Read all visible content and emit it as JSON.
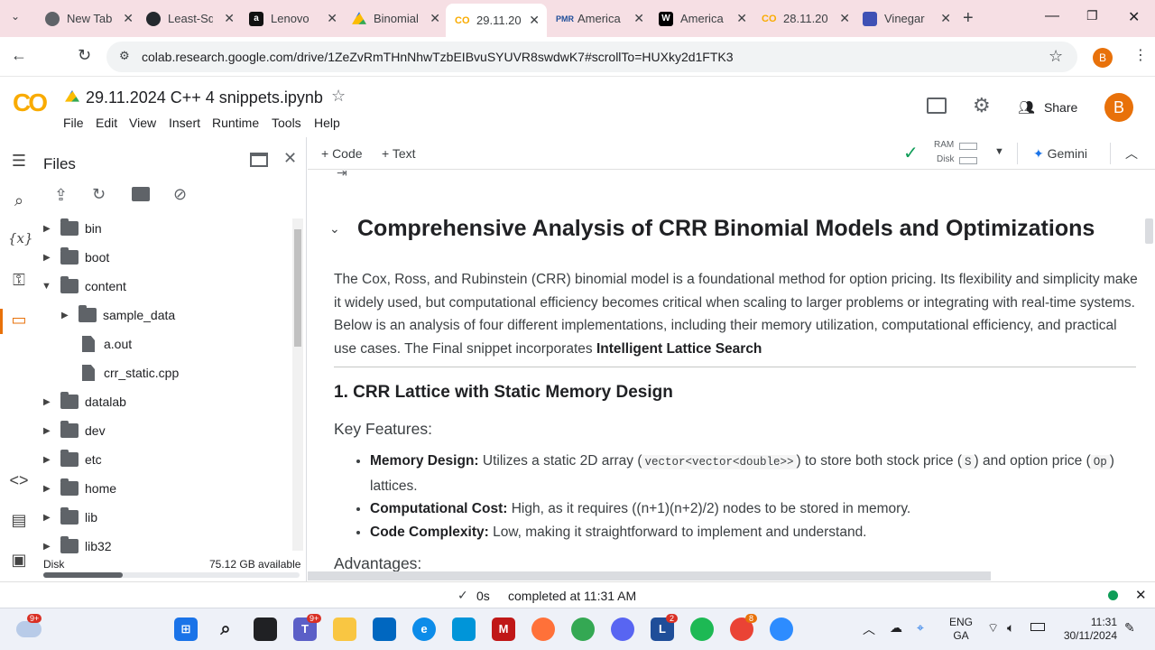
{
  "browser": {
    "tabs": [
      {
        "label": "New Tab",
        "icon": "chrome-icon",
        "color": "#5f6368"
      },
      {
        "label": "Least-Sq",
        "icon": "github-icon",
        "color": "#24292e"
      },
      {
        "label": "Lenovo",
        "icon": "amazon-icon",
        "color": "#111111"
      },
      {
        "label": "Binomial",
        "icon": "google-drive-icon",
        "color": "#1a73e8"
      },
      {
        "label": "29.11.20",
        "icon": "colab-icon",
        "color": "#f9ab00"
      },
      {
        "label": "America",
        "icon": "pmr-icon",
        "color": "#1f4e99"
      },
      {
        "label": "America",
        "icon": "wikipedia-icon",
        "color": "#000000"
      },
      {
        "label": "28.11.20",
        "icon": "colab-icon",
        "color": "#f9ab00"
      },
      {
        "label": "Vinegar",
        "icon": "forms-icon",
        "color": "#3f51b5"
      }
    ],
    "url": "colab.research.google.com/drive/1ZeZvRmTHnNhwTzbEIBvuSYUVR8swdwK7#scrollTo=HUXky2d1FTK3",
    "profile_initial": "B"
  },
  "colab": {
    "logo_text": "CO",
    "notebook_title": "29.11.2024 C++ 4 snippets.ipynb",
    "menus": [
      "File",
      "Edit",
      "View",
      "Insert",
      "Runtime",
      "Tools",
      "Help"
    ],
    "share_label": "Share",
    "avatar_initial": "B",
    "toolbar": {
      "code_label": "+ Code",
      "text_label": "+ Text",
      "ram_label": "RAM",
      "disk_label": "Disk",
      "gemini_label": "Gemini"
    }
  },
  "files_panel": {
    "title": "Files",
    "tree": [
      {
        "name": "bin",
        "type": "folder",
        "depth": 0,
        "expanded": false
      },
      {
        "name": "boot",
        "type": "folder",
        "depth": 0,
        "expanded": false
      },
      {
        "name": "content",
        "type": "folder",
        "depth": 0,
        "expanded": true
      },
      {
        "name": "sample_data",
        "type": "folder",
        "depth": 1,
        "expanded": false
      },
      {
        "name": "a.out",
        "type": "file",
        "depth": 1
      },
      {
        "name": "crr_static.cpp",
        "type": "file",
        "depth": 1
      },
      {
        "name": "datalab",
        "type": "folder",
        "depth": 0,
        "expanded": false
      },
      {
        "name": "dev",
        "type": "folder",
        "depth": 0,
        "expanded": false
      },
      {
        "name": "etc",
        "type": "folder",
        "depth": 0,
        "expanded": false
      },
      {
        "name": "home",
        "type": "folder",
        "depth": 0,
        "expanded": false
      },
      {
        "name": "lib",
        "type": "folder",
        "depth": 0,
        "expanded": false
      },
      {
        "name": "lib32",
        "type": "folder",
        "depth": 0,
        "expanded": false
      }
    ],
    "disk_label": "Disk",
    "disk_available": "75.12 GB available",
    "disk_used_fraction": 0.31
  },
  "notebook": {
    "heading": "Comprehensive Analysis of CRR Binomial Models and Optimizations",
    "intro": "The Cox, Ross, and Rubinstein (CRR) binomial model is a foundational method for option pricing. Its flexibility and simplicity make it widely used, but computational efficiency becomes critical when scaling to larger problems or integrating with real-time systems. Below is an analysis of four different implementations, including their memory utilization, computational efficiency, and practical use cases. The Final snippet incorporates",
    "intro_bold": "Intelligent Lattice Search",
    "section1_title": "1. CRR Lattice with Static Memory Design",
    "key_features_label": "Key Features:",
    "features": [
      {
        "label": "Memory Design:",
        "text_a": "Utilizes a static 2D array (",
        "code_a": "vector<vector<double>>",
        "text_b": ") to store both stock price (",
        "code_b": "S",
        "text_c": ") and option price (",
        "code_c": "Op",
        "text_d": ") lattices."
      },
      {
        "label": "Computational Cost:",
        "text": "High, as it requires ((n+1)(n+2)/2) nodes to be stored in memory."
      },
      {
        "label": "Code Complexity:",
        "text": "Low, making it straightforward to implement and understand."
      }
    ],
    "advantages_label": "Advantages:"
  },
  "status_bar": {
    "duration": "0s",
    "completed_text": "completed at 11:31 AM"
  },
  "taskbar": {
    "lang_line1": "ENG",
    "lang_line2": "GA",
    "time": "11:31",
    "date": "30/11/2024",
    "badge_weather": "9+",
    "badge_teams": "9+",
    "badge_chrome": "8",
    "badge_l": "2"
  }
}
